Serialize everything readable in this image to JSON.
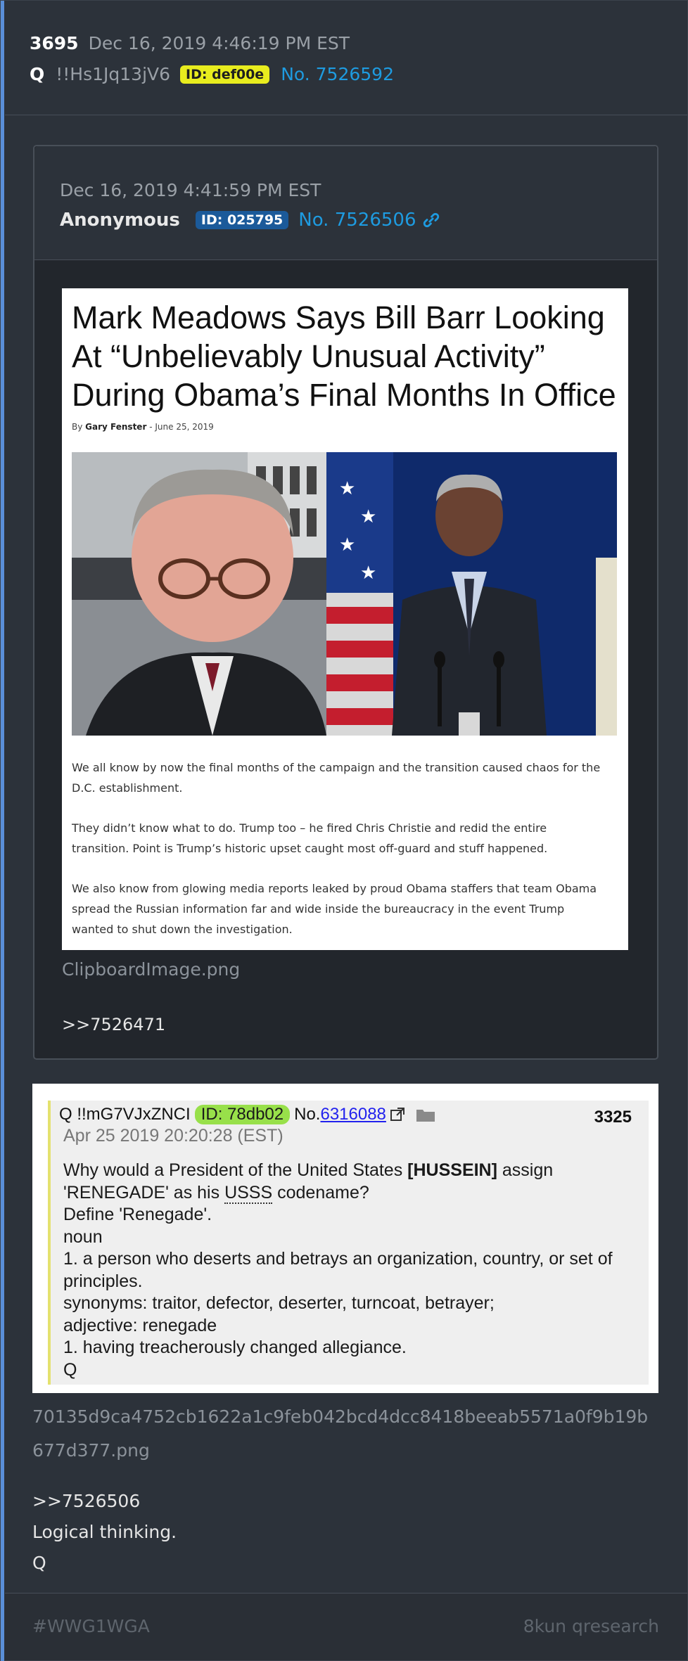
{
  "post": {
    "number": "3695",
    "date": "Dec 16, 2019 4:46:19 PM EST",
    "author": "Q",
    "tripcode": "!!Hs1Jq13jV6",
    "id_badge": "ID: def00e",
    "post_no": "No. 7526592"
  },
  "quoted": {
    "date": "Dec 16, 2019 4:41:59 PM EST",
    "author": "Anonymous",
    "id_badge": "ID: 025795",
    "post_no": "No. 7526506",
    "article": {
      "title": "Mark Meadows Says Bill Barr Looking At “Unbelievably Unusual Activity” During Obama’s Final Months In Office",
      "by_prefix": "By",
      "author": "Gary Fenster",
      "separator": "-",
      "date": "June 25, 2019",
      "paragraphs": [
        "We all know by now the final months of the campaign and the transition caused chaos for the D.C. establishment.",
        "They didn’t know what to do. Trump too – he fired Chris Christie and redid the entire transition. Point is Trump’s historic upset caught most off-guard and stuff happened.",
        "We also know from glowing media reports leaked by proud Obama staffers that team Obama spread the Russian information far and wide inside the bureaucracy in the event Trump wanted to shut down the investigation."
      ]
    },
    "filename": "ClipboardImage.png",
    "reply": ">>7526471"
  },
  "embedded": {
    "trip": "Q !!mG7VJxZNCI",
    "id_badge": "ID: 78db02",
    "no_prefix": "No.",
    "no_link": "6316088",
    "count": "3325",
    "date": "Apr 25 2019 20:20:28 (EST)",
    "line1_pre": "Why would a President of the United States ",
    "line1_bold": "[HUSSEIN]",
    "line1_post": " assign",
    "line2_pre": "'RENEGADE' as his ",
    "line2_uss": "USSS",
    "line2_post": " codename?",
    "line3": "Define 'Renegade'.",
    "line4": "noun",
    "line5": "1. a person who deserts and betrays an organization, country, or set of principles.",
    "line6": "synonyms: traitor, defector, deserter, turncoat, betrayer;",
    "line7": "adjective: renegade",
    "line8": "1. having treacherously changed allegiance.",
    "line9": "Q"
  },
  "attachment_filename": "70135d9ca4752cb1622a1c9feb042bcd4dcc8418beeab5571a0f9b19b677d377.png",
  "reply_lines": [
    ">>7526506",
    "Logical thinking.",
    "Q"
  ],
  "footer": {
    "hashtag": "#WWG1WGA",
    "source": "8kun qresearch"
  },
  "colors": {
    "accent": "#5a8fd8",
    "link": "#1e9be0",
    "id_yellow": "#e8ec1e",
    "id_blue": "#1b5a9a",
    "id_green": "#98e04a"
  }
}
